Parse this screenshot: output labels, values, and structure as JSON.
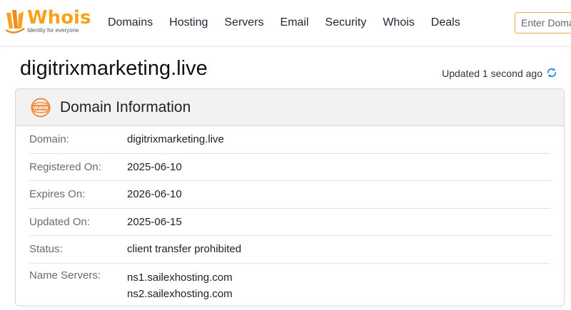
{
  "brand": {
    "name": "Whois",
    "tagline": "Identity for everyone",
    "accent": "#f7a21b"
  },
  "nav": {
    "items": [
      {
        "label": "Domains"
      },
      {
        "label": "Hosting"
      },
      {
        "label": "Servers"
      },
      {
        "label": "Email"
      },
      {
        "label": "Security"
      },
      {
        "label": "Whois"
      },
      {
        "label": "Deals"
      }
    ],
    "search_placeholder": "Enter Domain or IP"
  },
  "page": {
    "title": "digitrixmarketing.live",
    "updated_text": "Updated 1 second ago"
  },
  "card": {
    "title": "Domain Information",
    "rows": [
      {
        "label": "Domain:",
        "value": "digitrixmarketing.live"
      },
      {
        "label": "Registered On:",
        "value": "2025-06-10"
      },
      {
        "label": "Expires On:",
        "value": "2026-06-10"
      },
      {
        "label": "Updated On:",
        "value": "2025-06-15"
      },
      {
        "label": "Status:",
        "value": "client transfer prohibited"
      },
      {
        "label": "Name Servers:",
        "values": [
          "ns1.sailexhosting.com",
          "ns2.sailexhosting.com"
        ]
      }
    ]
  },
  "icons": {
    "logo": "whois-logo-icon",
    "refresh": "refresh-icon",
    "www": "www-globe-icon"
  },
  "colors": {
    "search_border": "#f3a847",
    "refresh": "#2a8ad6",
    "www_icon": "#f08a3c"
  }
}
